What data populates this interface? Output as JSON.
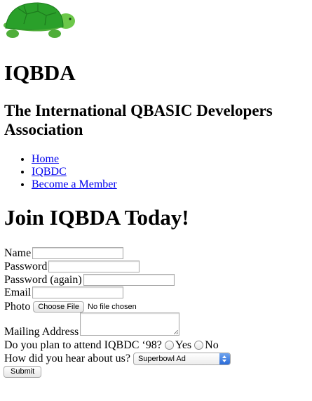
{
  "header": {
    "logo": "turtle-logo",
    "title": "IQBDA",
    "subtitle": "The International QBASIC Developers Association"
  },
  "nav": {
    "items": [
      {
        "label": "Home"
      },
      {
        "label": "IQBDC"
      },
      {
        "label": "Become a Member"
      }
    ]
  },
  "form": {
    "heading": "Join IQBDA Today!",
    "name_label": "Name",
    "name_value": "",
    "password_label": "Password",
    "password_again_label": "Password (again)",
    "email_label": "Email",
    "photo_label": "Photo",
    "choose_file_label": "Choose File",
    "no_file_text": "No file chosen",
    "mailing_label": "Mailing Address",
    "attend_label": "Do you plan to attend IQBDC ‘98?",
    "yes_label": "Yes",
    "no_label": "No",
    "hear_label": "How did you hear about us?",
    "hear_selected": "Superbowl Ad",
    "submit_label": "Submit"
  },
  "colors": {
    "link": "#0000ee",
    "turtle_shell": "#2aa02a",
    "turtle_body": "#6cc84a",
    "select_accent": "#2a6bd8"
  }
}
